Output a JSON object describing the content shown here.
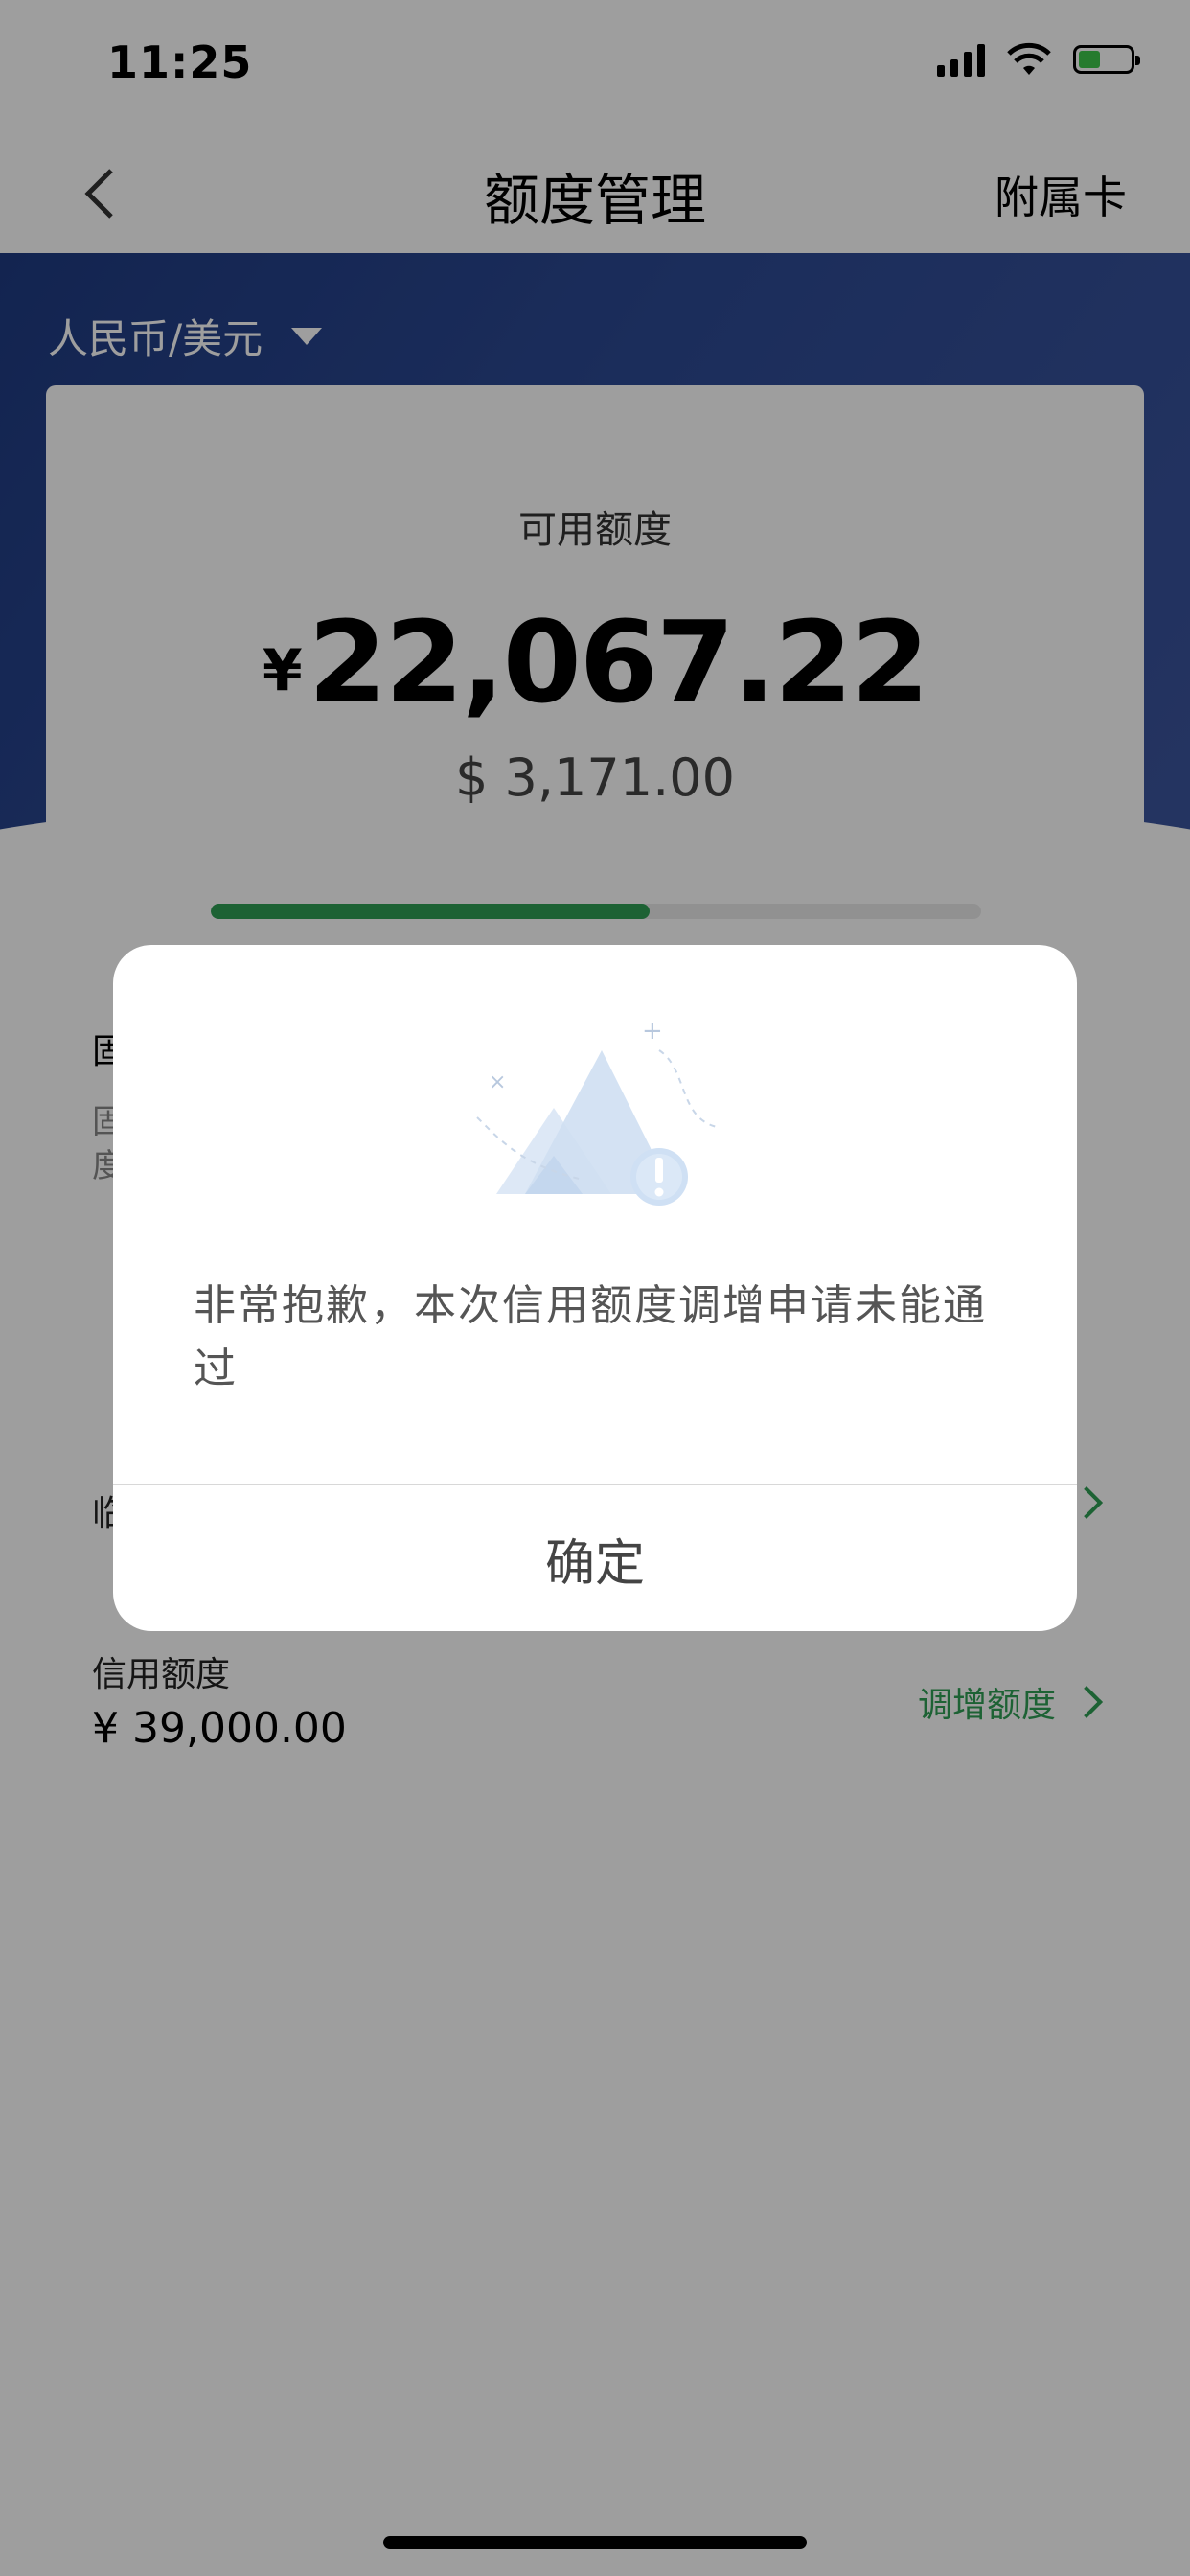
{
  "status_bar": {
    "time": "11:25"
  },
  "nav": {
    "title": "额度管理",
    "right_action": "附属卡"
  },
  "currency_selector": {
    "label": "人民币/美元"
  },
  "limit_card": {
    "available_label": "可用额度",
    "currency_symbol": "¥",
    "available_amount": "22,067.22",
    "usd_amount": "$ 3,171.00",
    "usage_fraction": 0.57,
    "fixed_label_fragment": "固",
    "fixed_desc_line1": "固",
    "fixed_desc_line2": "度"
  },
  "temp_limit_row": {
    "label_fragment": "临"
  },
  "credit_limit_row": {
    "label": "信用额度",
    "value": "¥ 39,000.00",
    "link_label": "调增额度"
  },
  "dialog": {
    "message": "非常抱歉，本次信用额度调增申请未能通过",
    "confirm_label": "确定"
  },
  "colors": {
    "accent_green": "#2f9e55",
    "hero_blue": "#2d4a94"
  }
}
